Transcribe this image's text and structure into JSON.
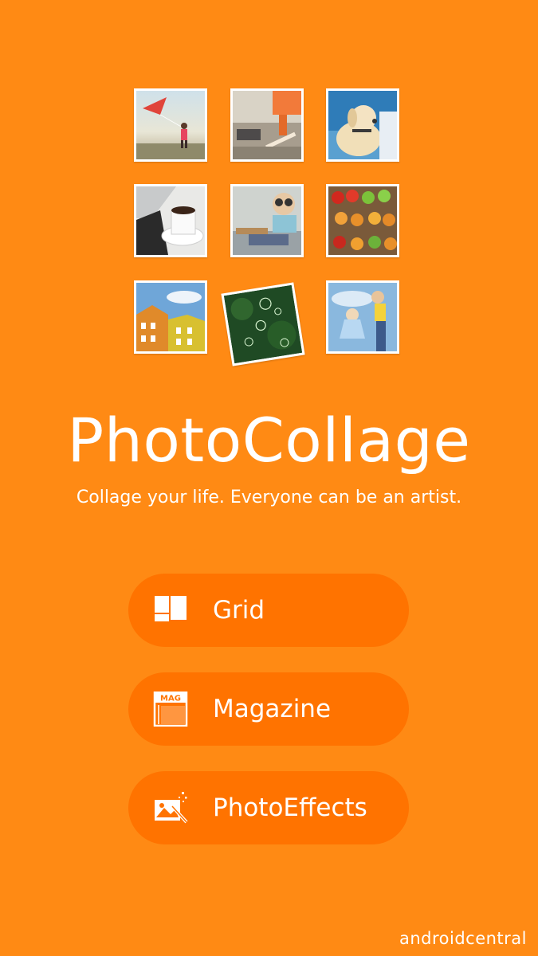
{
  "app": {
    "title": "PhotoCollage",
    "tagline": "Collage your life. Everyone can be an artist."
  },
  "gallery": {
    "photos": [
      "kite-photo",
      "skateboard-photo",
      "dog-photo",
      "coffee-photo",
      "aviator-kid-photo",
      "fruit-market-photo",
      "buildings-photo",
      "bubbles-photo",
      "child-swing-photo"
    ]
  },
  "menu": {
    "items": [
      {
        "label": "Grid",
        "icon": "grid-icon"
      },
      {
        "label": "Magazine",
        "icon": "magazine-icon",
        "icon_text": "MAG"
      },
      {
        "label": "PhotoEffects",
        "icon": "photo-effects-icon"
      }
    ]
  },
  "watermark": "androidcentral",
  "colors": {
    "background": "#FF8A14",
    "button": "#FF7300",
    "text": "#FFFFFF"
  }
}
